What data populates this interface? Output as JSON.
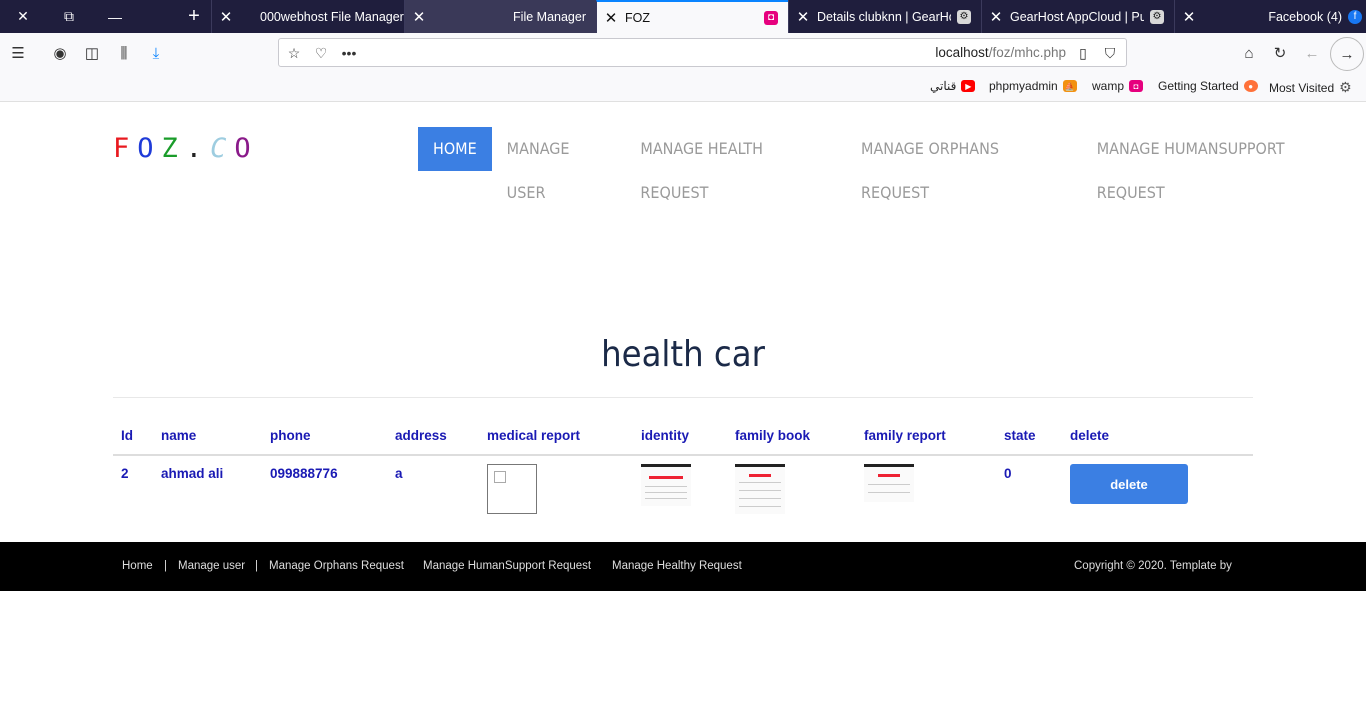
{
  "browser": {
    "tabs": [
      {
        "title": "000webhost File Manager"
      },
      {
        "title": "File Manager"
      },
      {
        "title": "FOZ"
      },
      {
        "title": "Details clubknn | GearHo"
      },
      {
        "title": "GearHost AppCloud | Pu"
      },
      {
        "title": "Facebook (4)"
      }
    ],
    "url_host": "localhost",
    "url_path": "/foz/mhc.php",
    "bookmarks": [
      {
        "label": "قناتي",
        "icon": "youtube-icon",
        "color": "#ff0000"
      },
      {
        "label": "phpmyadmin",
        "icon": "phpmyadmin-icon",
        "color": "#f29111"
      },
      {
        "label": "wamp",
        "icon": "wamp-icon",
        "color": "#e6007e"
      },
      {
        "label": "Getting Started",
        "icon": "firefox-icon",
        "color": "#ff7139"
      },
      {
        "label": "Most Visited",
        "icon": "gear-icon",
        "color": "#555555"
      }
    ]
  },
  "site": {
    "logo": [
      "F",
      "O",
      "Z",
      ".",
      "C",
      "O"
    ],
    "logo_colors": [
      "#e8191f",
      "#1f3bd8",
      "#1a9c2a",
      "#222222",
      "#9ecde0",
      "#8a1a8a"
    ],
    "nav": [
      "HOME",
      "MANAGE USER",
      "MANAGE HEALTH REQUEST",
      "MANAGE ORPHANS REQUEST",
      "MANAGE HUMANSUPPORT REQUEST"
    ],
    "accent": "#3b7fe3"
  },
  "main": {
    "title": "health car",
    "columns": [
      "Id",
      "name",
      "phone",
      "address",
      "medical report",
      "identity",
      "family book",
      "family report",
      "state",
      "delete"
    ],
    "rows": [
      {
        "id": "2",
        "name": "ahmad ali",
        "phone": "099888776",
        "address": "a",
        "state": "0",
        "delete_label": "delete"
      }
    ]
  },
  "footer": {
    "links": [
      "Home",
      "|",
      "Manage user",
      "|",
      "Manage Orphans Request",
      "Manage HumanSupport Request",
      "Manage Healthy Request"
    ],
    "copyright": "Copyright © 2020. Template by"
  }
}
